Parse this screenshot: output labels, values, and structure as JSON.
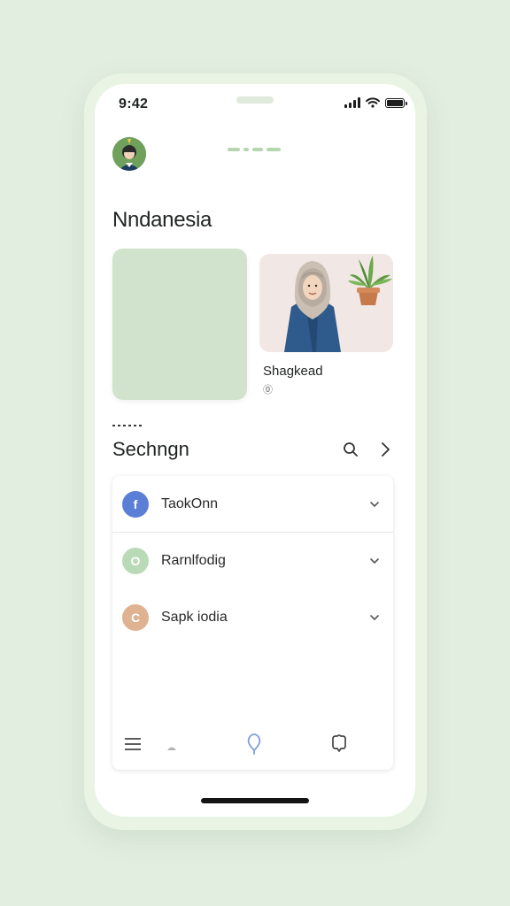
{
  "status_bar": {
    "time": "9:42"
  },
  "header": {
    "title": "Nndanesia"
  },
  "cards": {
    "featured": {
      "title": "Shagkead",
      "sub": "⓪"
    }
  },
  "section": {
    "title": "Sechngn"
  },
  "list": {
    "items": [
      {
        "label": "TaokOnn",
        "icon": "facebook-icon",
        "glyph": "f",
        "color": "#5b7fd6",
        "glyph_color": "#ffffff"
      },
      {
        "label": "Rarnlfodig",
        "icon": "circle-o-icon",
        "glyph": "O",
        "color": "#b9dab6",
        "glyph_color": "#ffffff"
      },
      {
        "label": "Sapk iodia",
        "icon": "circle-c-icon",
        "glyph": "C",
        "color": "#dfb291",
        "glyph_color": "#ffffff"
      }
    ]
  },
  "colors": {
    "background": "#e2eee0",
    "frame": "#e9f4e5",
    "accent_green": "#d1e3cc",
    "accent_blue": "#7a9fd8"
  }
}
